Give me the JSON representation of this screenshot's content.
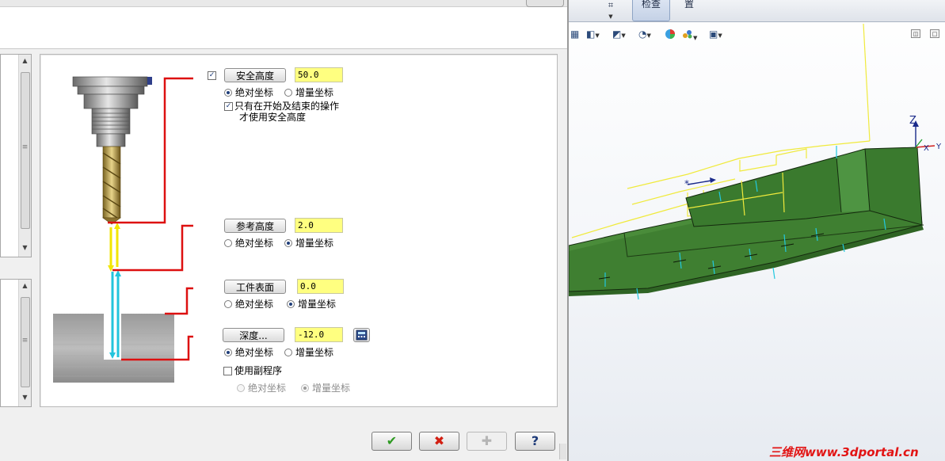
{
  "dialog": {
    "params": {
      "clearance": {
        "label": "安全高度",
        "value": "50.0",
        "enabled": true,
        "coord_abs": "绝对坐标",
        "coord_inc": "增量坐标",
        "selected": "abs",
        "only_start_end_line1": "只有在开始及结束的操作",
        "only_start_end_line2": "才使用安全高度",
        "only_start_end_checked": true
      },
      "retract": {
        "label": "参考高度",
        "value": "2.0",
        "coord_abs": "绝对坐标",
        "coord_inc": "增量坐标",
        "selected": "inc"
      },
      "top_of_stock": {
        "label": "工件表面",
        "value": "0.0",
        "coord_abs": "绝对坐标",
        "coord_inc": "增量坐标",
        "selected": "inc"
      },
      "depth": {
        "label": "深度...",
        "value": "-12.0",
        "calculator_icon": "calculator-icon",
        "coord_abs": "绝对坐标",
        "coord_inc": "增量坐标",
        "selected": "abs"
      },
      "subprogram": {
        "label": "使用副程序",
        "checked": false,
        "coord_abs": "绝对坐标",
        "coord_inc": "增量坐标",
        "selected": "inc"
      }
    },
    "footer": {
      "ok_icon": "checkmark-icon",
      "cancel_icon": "x-icon",
      "add_icon": "plus-circle-icon",
      "help_icon": "question-icon",
      "ok_glyph": "✔",
      "cancel_glyph": "✖",
      "add_glyph": "✚",
      "help_glyph": "?"
    },
    "colors": {
      "input_bg": "#ffff80",
      "leader_red": "#dd1010",
      "rapid_yellow": "#f2e600",
      "feed_cyan": "#22c4dc"
    }
  },
  "solidworks": {
    "tabs": [
      "检查",
      "置"
    ],
    "axes": {
      "z": "Z",
      "x": "X",
      "y": "Y"
    },
    "colors": {
      "part_green": "#3c7a2e",
      "toolpath_yellow": "#f0ea3c"
    }
  },
  "watermark": "三维网www.3dportal.cn"
}
